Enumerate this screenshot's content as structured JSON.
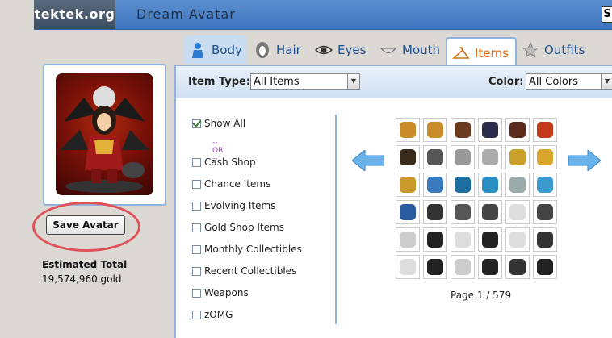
{
  "header": {
    "site": "tektek.org",
    "title": "Dream Avatar",
    "corner_label": "S"
  },
  "avatar": {
    "save_label": "Save Avatar",
    "estimated_label": "Estimated Total",
    "estimated_value": "19,574,960 gold"
  },
  "tabs": [
    {
      "label": "Body",
      "icon": "person-icon"
    },
    {
      "label": "Hair",
      "icon": "hair-icon"
    },
    {
      "label": "Eyes",
      "icon": "eye-icon"
    },
    {
      "label": "Mouth",
      "icon": "mouth-icon"
    },
    {
      "label": "Items",
      "icon": "hanger-icon"
    },
    {
      "label": "Outfits",
      "icon": "star-icon"
    }
  ],
  "filter": {
    "item_type_label": "Item Type:",
    "item_type_value": "All Items",
    "color_label": "Color:",
    "color_value": "All Colors"
  },
  "categories": {
    "show_all": "Show All",
    "or_text": "-- OR --",
    "items": [
      "Cash Shop",
      "Chance Items",
      "Evolving Items",
      "Gold Shop Items",
      "Monthly Collectibles",
      "Recent Collectibles",
      "Weapons",
      "zOMG"
    ]
  },
  "pagination": {
    "text": "Page 1 / 579"
  },
  "colors": {
    "accent": "#3f74bd",
    "active_tab": "#e06a16",
    "arrow": "#6ab2ea",
    "highlight_ring": "#e0525a"
  }
}
